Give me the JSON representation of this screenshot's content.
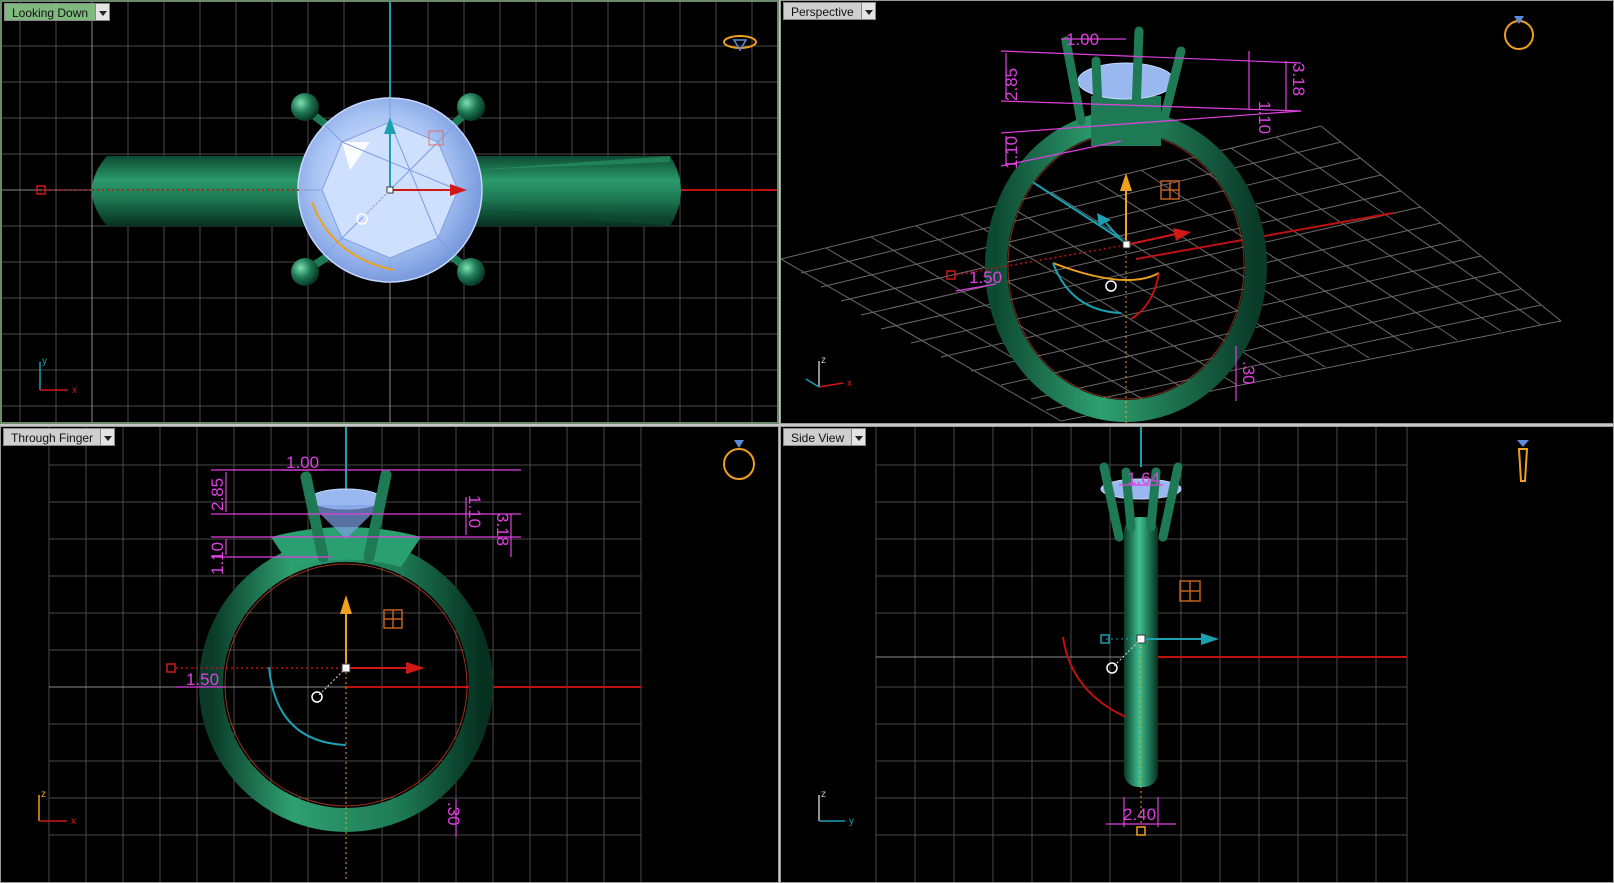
{
  "viewports": {
    "top": {
      "title": "Looking Down",
      "axis_labels": {
        "up": "y",
        "right": "x"
      }
    },
    "perspective": {
      "title": "Perspective",
      "axis_labels": {
        "up": "z",
        "right": "x"
      },
      "dims": {
        "prong_width": "1.00",
        "height_a": "2.85",
        "height_b": "1.10",
        "gap": "1.10",
        "total": "3.18",
        "band": "1.50",
        "shank": ".30"
      }
    },
    "front": {
      "title": "Through Finger",
      "axis_labels": {
        "up": "z",
        "right": "x"
      },
      "dims": {
        "prong_width": "1.00",
        "height_a": "2.85",
        "height_b": "1.10",
        "gap": "1.10",
        "total": "3.18",
        "band": "1.50",
        "shank": ".30"
      }
    },
    "right": {
      "title": "Side View",
      "axis_labels": {
        "up": "z",
        "right": "y"
      },
      "dims": {
        "top_width": "1.64",
        "bottom_width": "2.40"
      }
    }
  },
  "colors": {
    "ring": "#1e7a55",
    "gem": "#9ab8f0",
    "dimension": "#e040e0",
    "x_axis": "#d01818",
    "y_axis": "#1aa0b0",
    "z_axis": "#f0a020",
    "grid": "#5a5a5a",
    "active_border": "#7fb97f"
  }
}
